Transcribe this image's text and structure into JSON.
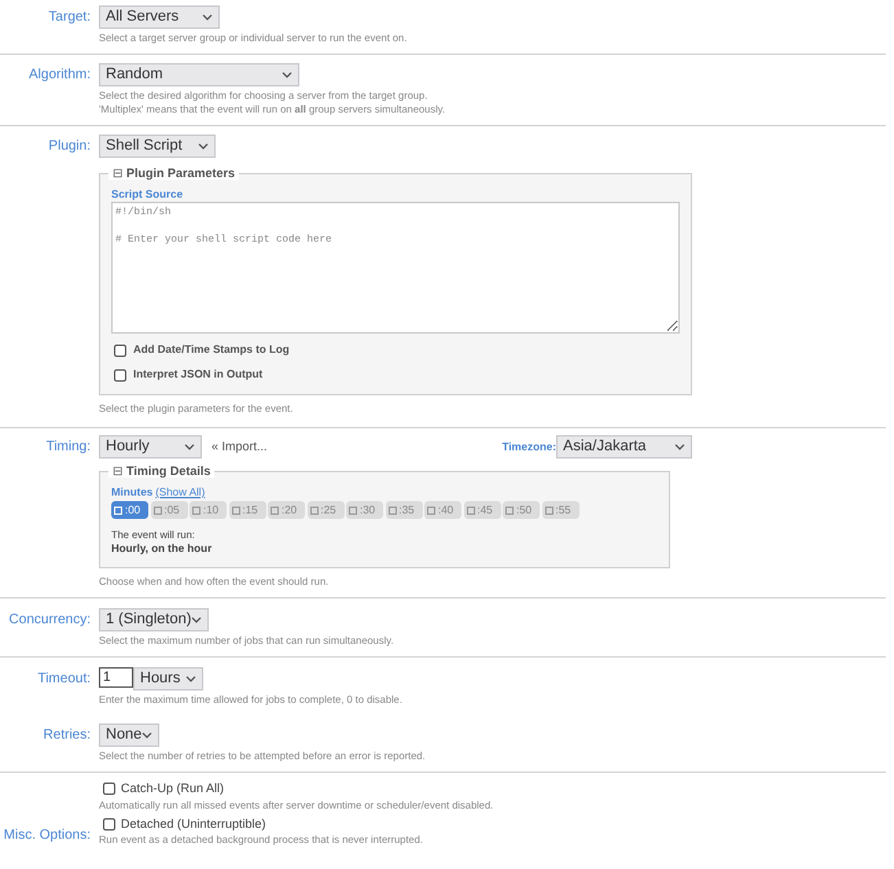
{
  "target": {
    "label": "Target:",
    "value": "All Servers",
    "hint": "Select a target server group or individual server to run the event on."
  },
  "algorithm": {
    "label": "Algorithm:",
    "value": "Random",
    "hints": [
      "Select the desired algorithm for choosing a server from the target group.",
      "'Multiplex' means that the event will run on **all** group servers simultaneously."
    ]
  },
  "plugin": {
    "label": "Plugin:",
    "value": "Shell Script",
    "panel": {
      "toggle": "⊟",
      "title": "Plugin Parameters",
      "field_label": "Script Source",
      "code": "#!/bin/sh\n\n# Enter your shell script code here",
      "options": [
        {
          "label": "Add Date/Time Stamps to Log",
          "checked": false
        },
        {
          "label": "Interpret JSON in Output",
          "checked": false
        }
      ]
    },
    "hint": "Select the plugin parameters for the event."
  },
  "timing": {
    "label": "Timing:",
    "value": "Hourly",
    "import_link": "« Import...",
    "timezone_label": "Timezone:",
    "timezone": "Asia/Jakarta",
    "panel": {
      "toggle": "⊟",
      "title": "Timing Details",
      "minutes_label": "Minutes",
      "show_all": "(Show All)",
      "minutes": [
        {
          "label": ":00",
          "selected": true
        },
        {
          "label": ":05",
          "selected": false
        },
        {
          "label": ":10",
          "selected": false
        },
        {
          "label": ":15",
          "selected": false
        },
        {
          "label": ":20",
          "selected": false
        },
        {
          "label": ":25",
          "selected": false
        },
        {
          "label": ":30",
          "selected": false
        },
        {
          "label": ":35",
          "selected": false
        },
        {
          "label": ":40",
          "selected": false
        },
        {
          "label": ":45",
          "selected": false
        },
        {
          "label": ":50",
          "selected": false
        },
        {
          "label": ":55",
          "selected": false
        }
      ],
      "summary_label": "The event will run:",
      "summary": "Hourly, on the hour"
    },
    "hint": "Choose when and how often the event should run."
  },
  "concurrency": {
    "label": "Concurrency:",
    "value": "1 (Singleton)",
    "hint": "Select the maximum number of jobs that can run simultaneously."
  },
  "timeout": {
    "label": "Timeout:",
    "value": "1",
    "unit": "Hours",
    "hint": "Enter the maximum time allowed for jobs to complete, 0 to disable."
  },
  "retries": {
    "label": "Retries:",
    "value": "None",
    "hint": "Select the number of retries to be attempted before an error is reported."
  },
  "misc": {
    "label": "Misc. Options:",
    "options": [
      {
        "label": "Catch-Up (Run All)",
        "checked": false,
        "hint": "Automatically run all missed events after server downtime or scheduler/event disabled."
      },
      {
        "label": "Detached (Uninterruptible)",
        "checked": false,
        "hint": "Run event as a detached background process that is never interrupted."
      }
    ]
  }
}
